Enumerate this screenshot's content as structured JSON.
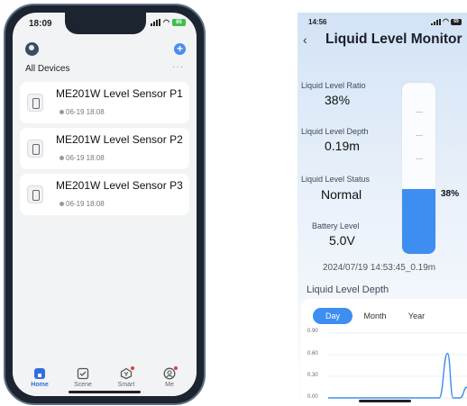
{
  "phone1": {
    "status": {
      "time": "18:09",
      "battery": "85"
    },
    "header": {
      "section_title": "All Devices",
      "more": "···"
    },
    "devices": [
      {
        "name": "ME201W Level Sensor",
        "tag": "P1",
        "last_seen": "06-19 18:08"
      },
      {
        "name": "ME201W Level Sensor",
        "tag": "P2",
        "last_seen": "06-19 18:08"
      },
      {
        "name": "ME201W Level Sensor",
        "tag": "P3",
        "last_seen": "06-19 18:08"
      }
    ],
    "tabs": [
      {
        "label": "Home",
        "icon": "home-icon",
        "active": true
      },
      {
        "label": "Scene",
        "icon": "scene-check-icon",
        "active": false
      },
      {
        "label": "Smart",
        "icon": "smart-icon",
        "active": false
      },
      {
        "label": "Me",
        "icon": "profile-icon",
        "active": false
      }
    ]
  },
  "phone2": {
    "status": {
      "time": "14:56",
      "battery": "69"
    },
    "back": "‹",
    "title": "Liquid Level Monitor",
    "metrics": [
      {
        "label": "Liquid Level Ratio",
        "value": "38%"
      },
      {
        "label": "Liquid Level Depth",
        "value": "0.19m"
      },
      {
        "label": "Liquid Level Status",
        "value": "Normal"
      },
      {
        "label": "Battery Level",
        "value": "5.0V"
      }
    ],
    "tank": {
      "level_fraction": 0.38,
      "label": "38%"
    },
    "timestamp": "2024/07/19 14:53:45_0.19m",
    "chart_section_title": "Liquid Level Depth",
    "periods": [
      {
        "label": "Day",
        "active": true
      },
      {
        "label": "Month",
        "active": false
      },
      {
        "label": "Year",
        "active": false
      }
    ]
  },
  "colors": {
    "accent": "#3d8ef0",
    "tab_active": "#2f6fe0",
    "notify": "#e5393b"
  },
  "chart_data": {
    "type": "line",
    "title": "Liquid Level Depth",
    "xlabel": "",
    "ylabel": "",
    "yticks": [
      "0.90",
      "0.60",
      "0.30",
      "0.00"
    ],
    "ylim": [
      0,
      0.9
    ],
    "series": [
      {
        "x": [
          0,
          0.5,
          0.8,
          0.86,
          0.9,
          0.95,
          1.0
        ],
        "values": [
          0.0,
          0.0,
          0.0,
          0.62,
          0.0,
          0.0,
          0.15
        ]
      }
    ],
    "grid": true,
    "legend": "none"
  }
}
